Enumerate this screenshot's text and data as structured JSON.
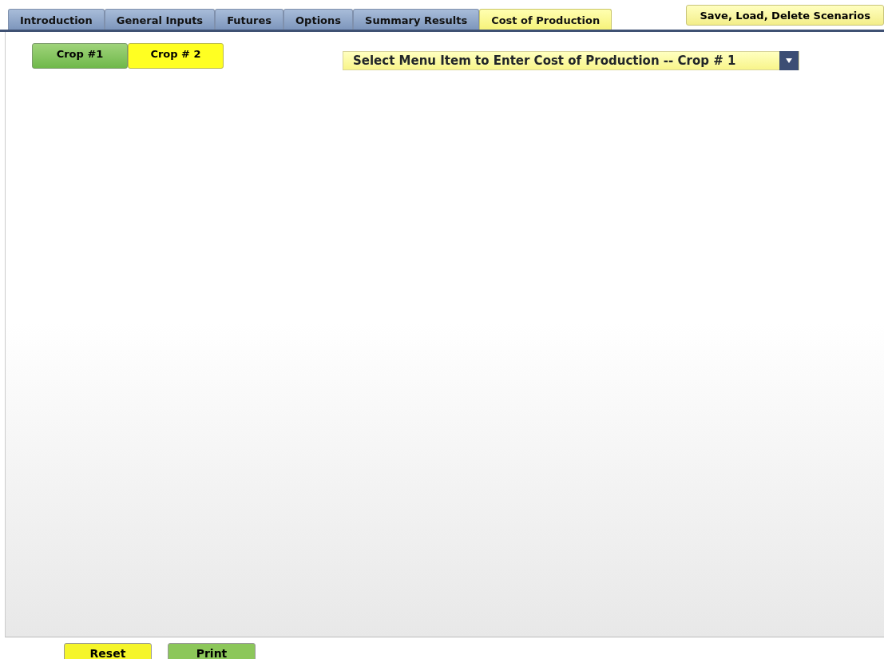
{
  "tabs": [
    {
      "label": "Introduction",
      "selected": false
    },
    {
      "label": "General Inputs",
      "selected": false
    },
    {
      "label": "Futures",
      "selected": false
    },
    {
      "label": "Options",
      "selected": false
    },
    {
      "label": "Summary Results",
      "selected": false
    },
    {
      "label": "Cost of Production",
      "selected": true
    }
  ],
  "scenarios_button": "Save, Load, Delete Scenarios",
  "crop_tabs": [
    {
      "label": "Crop #1",
      "selected": true
    },
    {
      "label": "Crop # 2",
      "selected": false
    }
  ],
  "menu_select": {
    "value": "Select Menu Item to Enter Cost of Production -- Crop # 1"
  },
  "footer_buttons": [
    {
      "label": "Reset",
      "color": "#f5f52a"
    },
    {
      "label": "Print",
      "color": "#8cc75a"
    }
  ]
}
